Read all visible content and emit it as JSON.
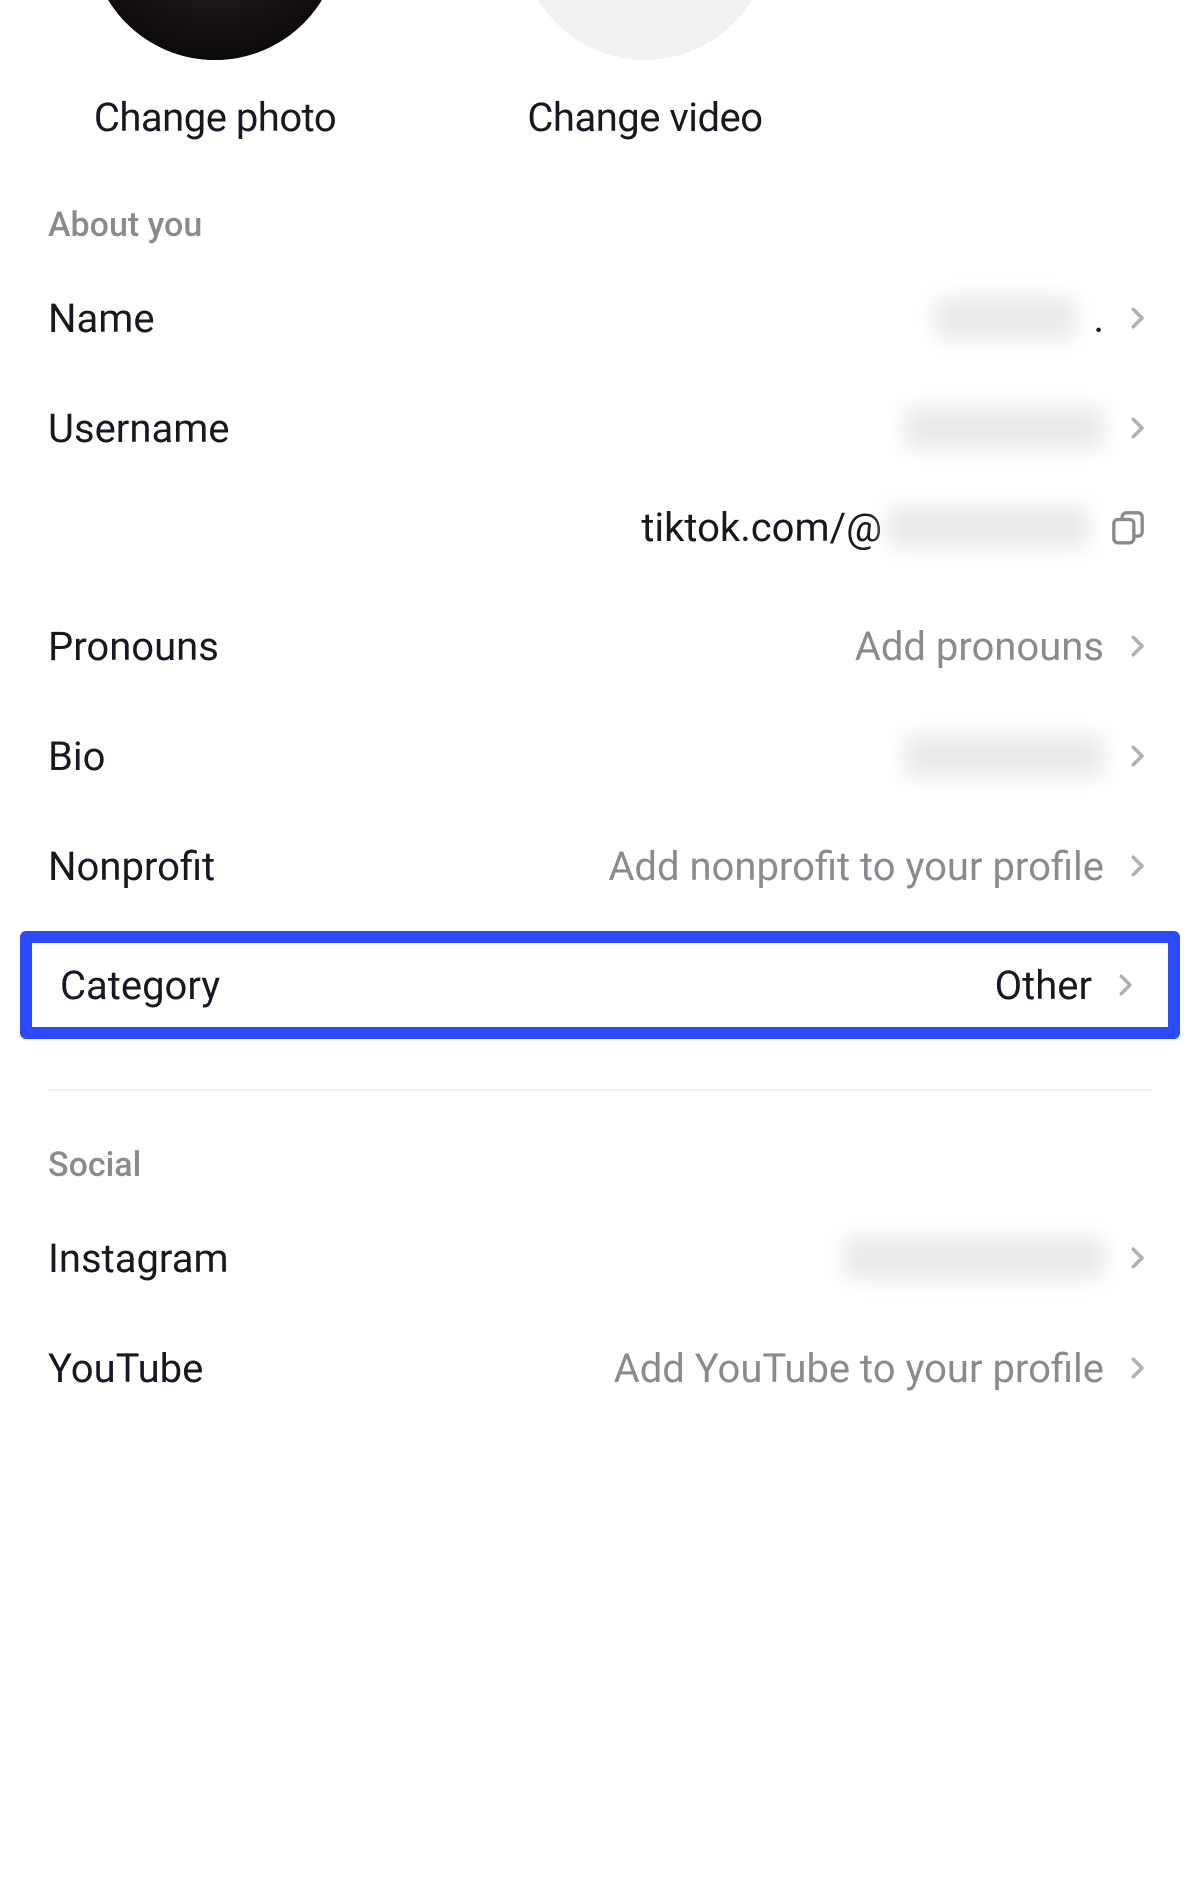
{
  "media": {
    "change_photo_label": "Change photo",
    "change_video_label": "Change video"
  },
  "sections": {
    "about_you": "About you",
    "social": "Social"
  },
  "about": {
    "name": {
      "label": "Name",
      "value_redacted": true
    },
    "username": {
      "label": "Username",
      "value_redacted": true
    },
    "profile_url_prefix": "tiktok.com/@",
    "profile_url_handle_redacted": true,
    "pronouns": {
      "label": "Pronouns",
      "placeholder": "Add pronouns"
    },
    "bio": {
      "label": "Bio",
      "value_redacted": true
    },
    "nonprofit": {
      "label": "Nonprofit",
      "placeholder": "Add nonprofit to your profile"
    },
    "category": {
      "label": "Category",
      "value": "Other"
    }
  },
  "social": {
    "instagram": {
      "label": "Instagram",
      "value_redacted": true
    },
    "youtube": {
      "label": "YouTube",
      "placeholder": "Add YouTube to your profile"
    }
  },
  "icons": {
    "chevron_color": "#b0b0b4",
    "copy_color": "#8a8b91"
  }
}
